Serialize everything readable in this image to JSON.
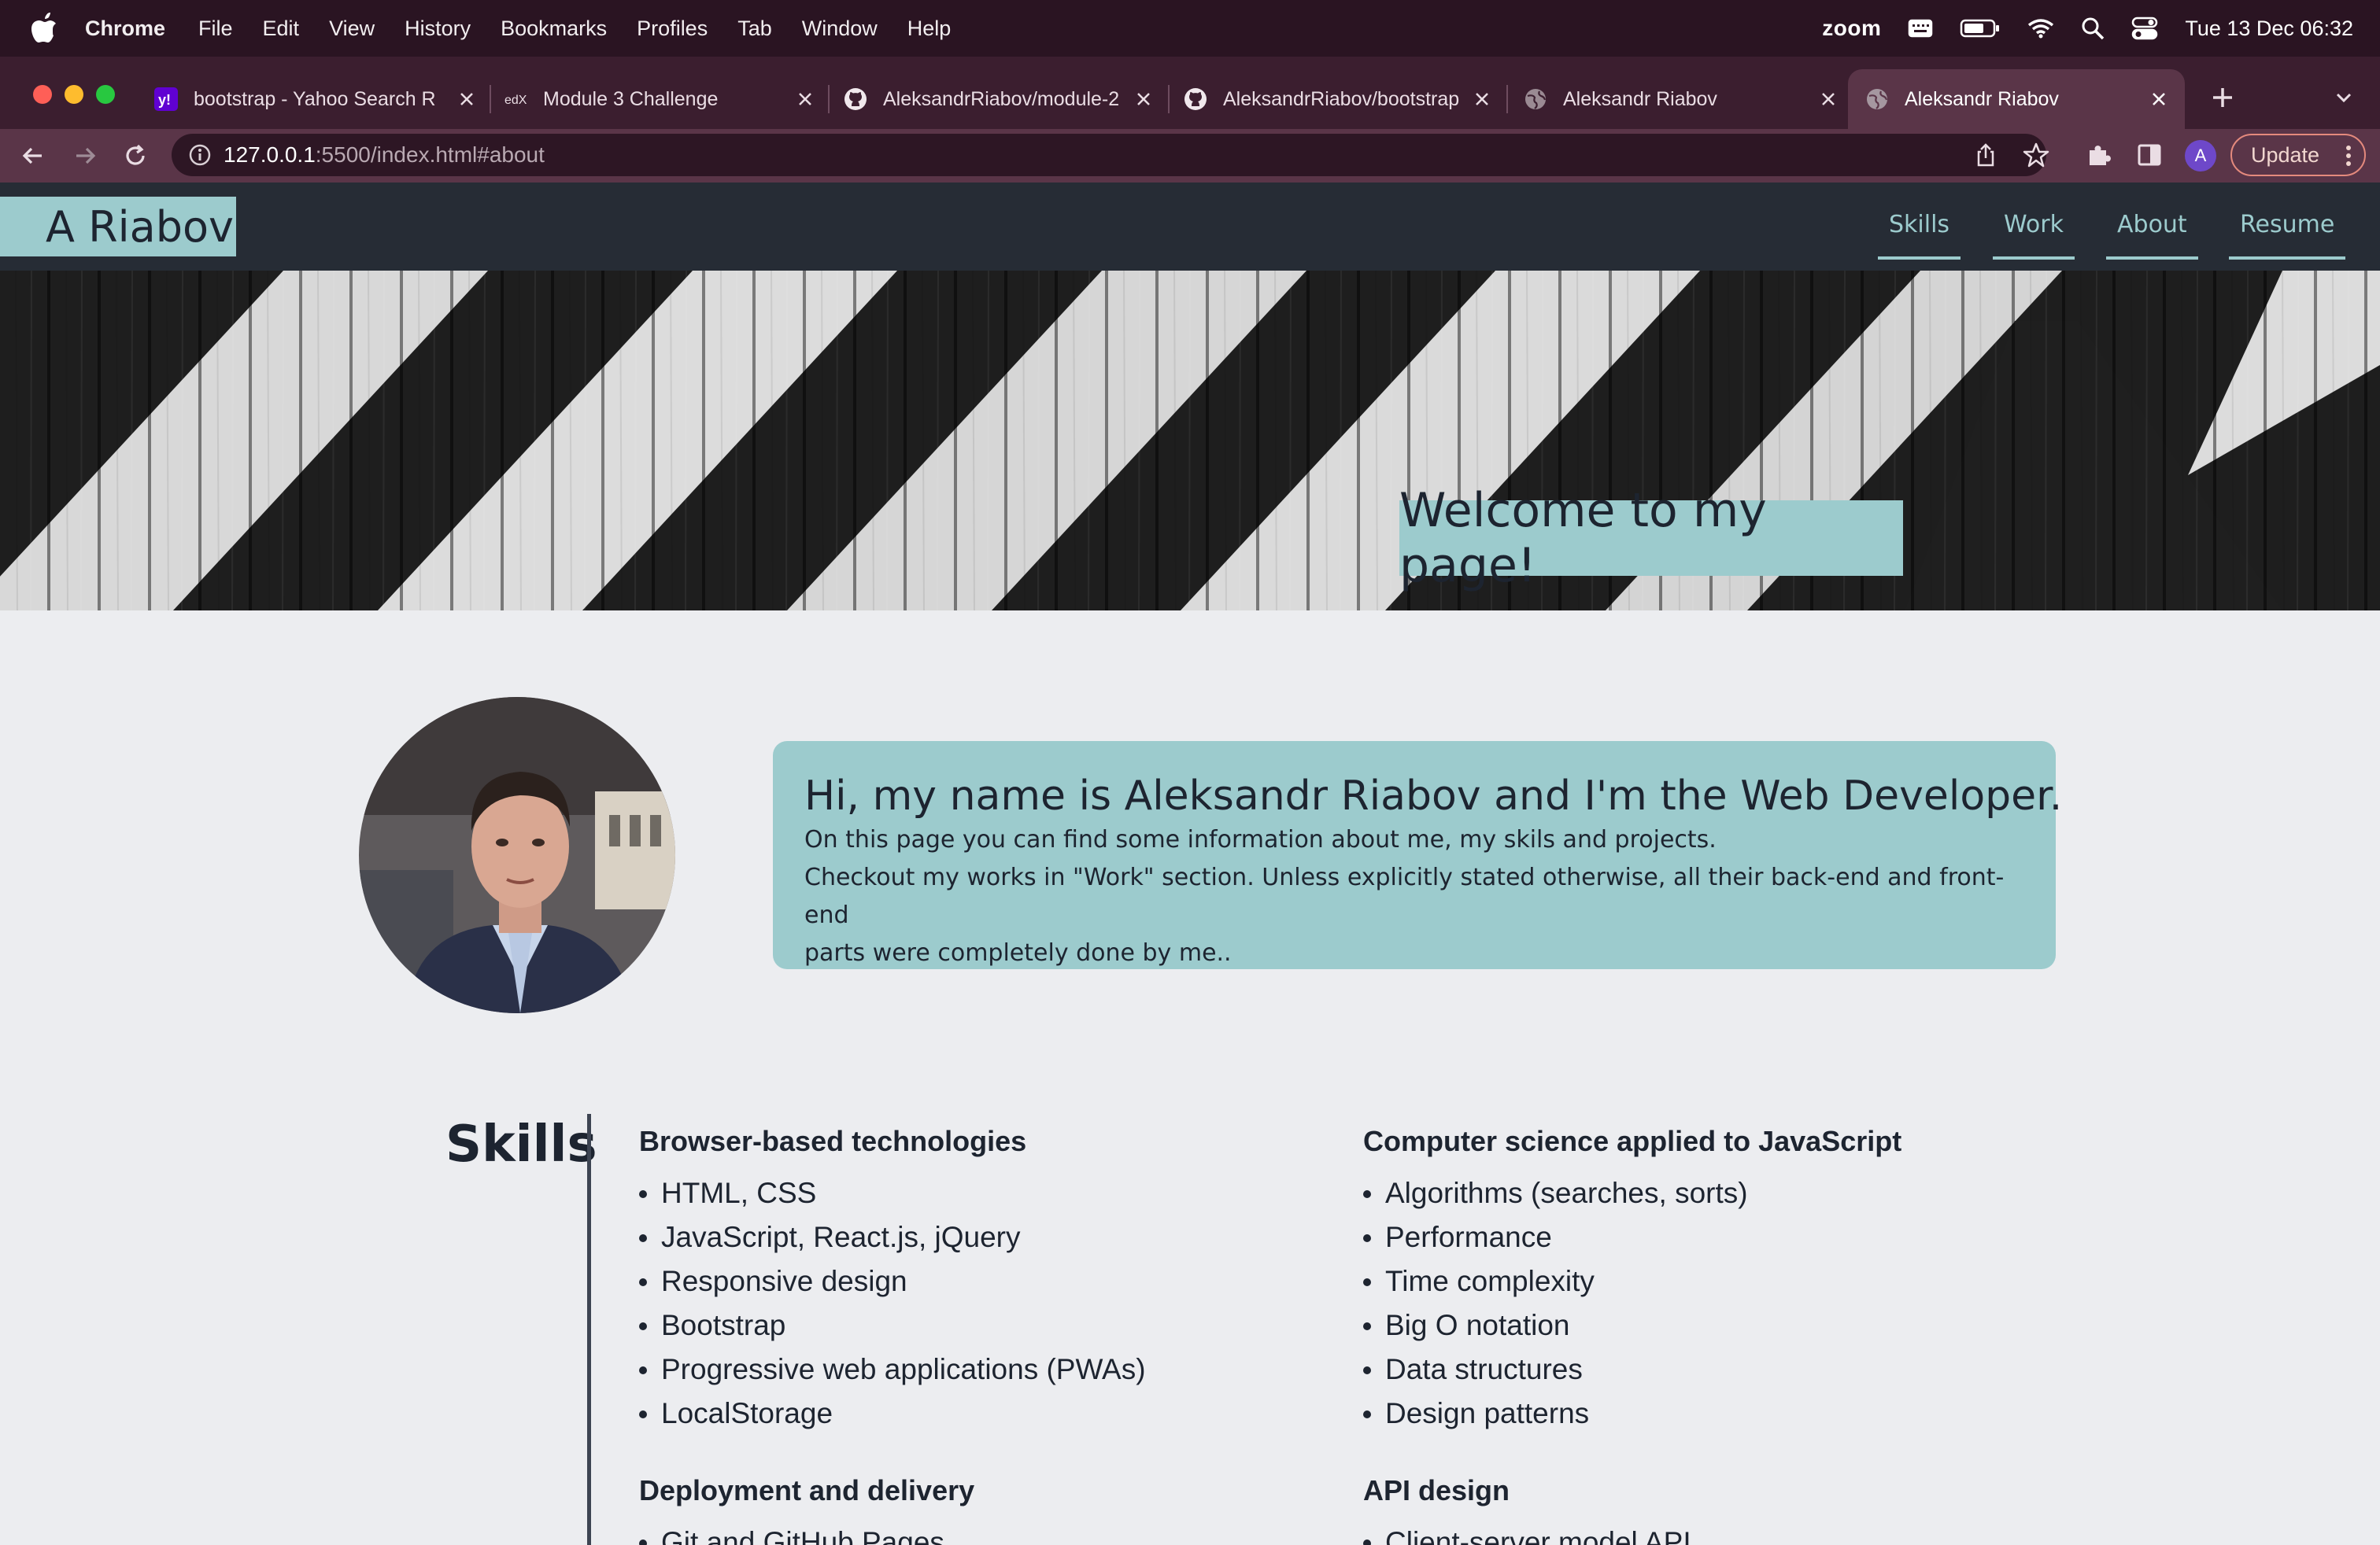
{
  "menubar": {
    "app_name": "Chrome",
    "items": [
      "File",
      "Edit",
      "View",
      "History",
      "Bookmarks",
      "Profiles",
      "Tab",
      "Window",
      "Help"
    ],
    "zoom_label": "zoom",
    "clock": "Tue 13 Dec  06:32"
  },
  "tabs": [
    {
      "title": "bootstrap - Yahoo Search R",
      "icon": "yahoo-icon"
    },
    {
      "title": "Module 3 Challenge",
      "icon": "edx-icon"
    },
    {
      "title": "AleksandrRiabov/module-2",
      "icon": "github-icon"
    },
    {
      "title": "AleksandrRiabov/bootstrap",
      "icon": "github-icon"
    },
    {
      "title": "Aleksandr Riabov",
      "icon": "globe-icon"
    },
    {
      "title": "Aleksandr Riabov",
      "icon": "globe-icon",
      "active": true
    }
  ],
  "address_bar": {
    "host": "127.0.0.1",
    "rest": ":5500/index.html#about"
  },
  "toolbar": {
    "profile_initial": "A",
    "update_label": "Update"
  },
  "site": {
    "brand": "A Riabov",
    "nav": [
      "Skills",
      "Work",
      "About",
      "Resume"
    ],
    "welcome": "Welcome to my page!",
    "bio_title": "Hi, my name is Aleksandr Riabov and I'm the Web Developer.",
    "bio_lines": [
      "On this page you can find some information about me, my skils and projects.",
      "Checkout my works in \"Work\" section. Unless explicitly stated otherwise, all their back-end and front-end",
      "parts were completely done by me.."
    ],
    "skills_heading": "Skills",
    "skill_groups": [
      {
        "title": "Browser-based technologies",
        "items": [
          "HTML, CSS",
          "JavaScript, React.js, jQuery",
          "Responsive design",
          "Bootstrap",
          "Progressive web applications (PWAs)",
          "LocalStorage"
        ]
      },
      {
        "title": "Computer science applied to JavaScript",
        "items": [
          "Algorithms (searches, sorts)",
          "Performance",
          "Time complexity",
          "Big O notation",
          "Data structures",
          "Design patterns"
        ]
      },
      {
        "title": "Deployment and delivery",
        "items": [
          "Git and GitHub Pages"
        ]
      },
      {
        "title": "API design",
        "items": [
          "Client-server model API"
        ]
      }
    ]
  },
  "colors": {
    "accent": "#9ccbcd",
    "header_bg": "#262c35",
    "page_bg": "#ecedf0",
    "text_dark": "#1d2430"
  }
}
